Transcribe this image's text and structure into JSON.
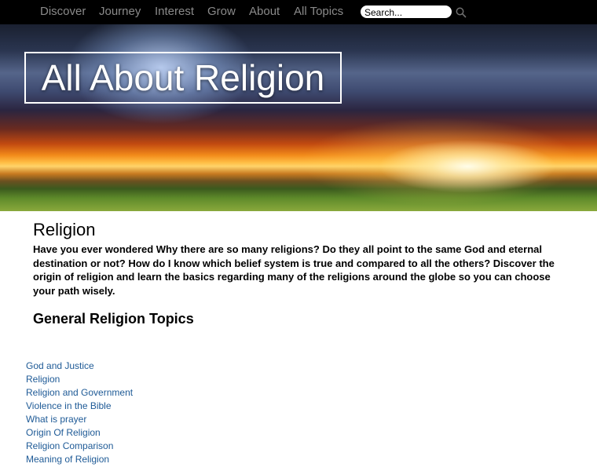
{
  "nav": {
    "items": [
      {
        "label": "Discover"
      },
      {
        "label": "Journey"
      },
      {
        "label": "Interest"
      },
      {
        "label": "Grow"
      },
      {
        "label": "About"
      },
      {
        "label": "All Topics"
      }
    ],
    "search_placeholder": "Search...",
    "search_icon": "magnifier-icon"
  },
  "hero": {
    "title": "All About Religion"
  },
  "main": {
    "title": "Religion",
    "intro": "Have you ever wondered Why there are so many religions? Do they all point to the same God and eternal destination or not? How do I know which belief system is true and compared to all the others? Discover the origin of religion and learn the basics regarding many of the religions around the globe so you can choose your path wisely.",
    "section_title": "General Religion Topics",
    "topics": [
      "God and Justice",
      "Religion",
      "Religion and Government",
      "Violence in the Bible",
      "What is prayer",
      "Origin Of Religion",
      "Religion Comparison",
      "Meaning of Religion"
    ]
  },
  "colors": {
    "nav_bg": "#000000",
    "nav_text": "#8a8a8a",
    "link": "#1e5a96",
    "text": "#000000"
  }
}
